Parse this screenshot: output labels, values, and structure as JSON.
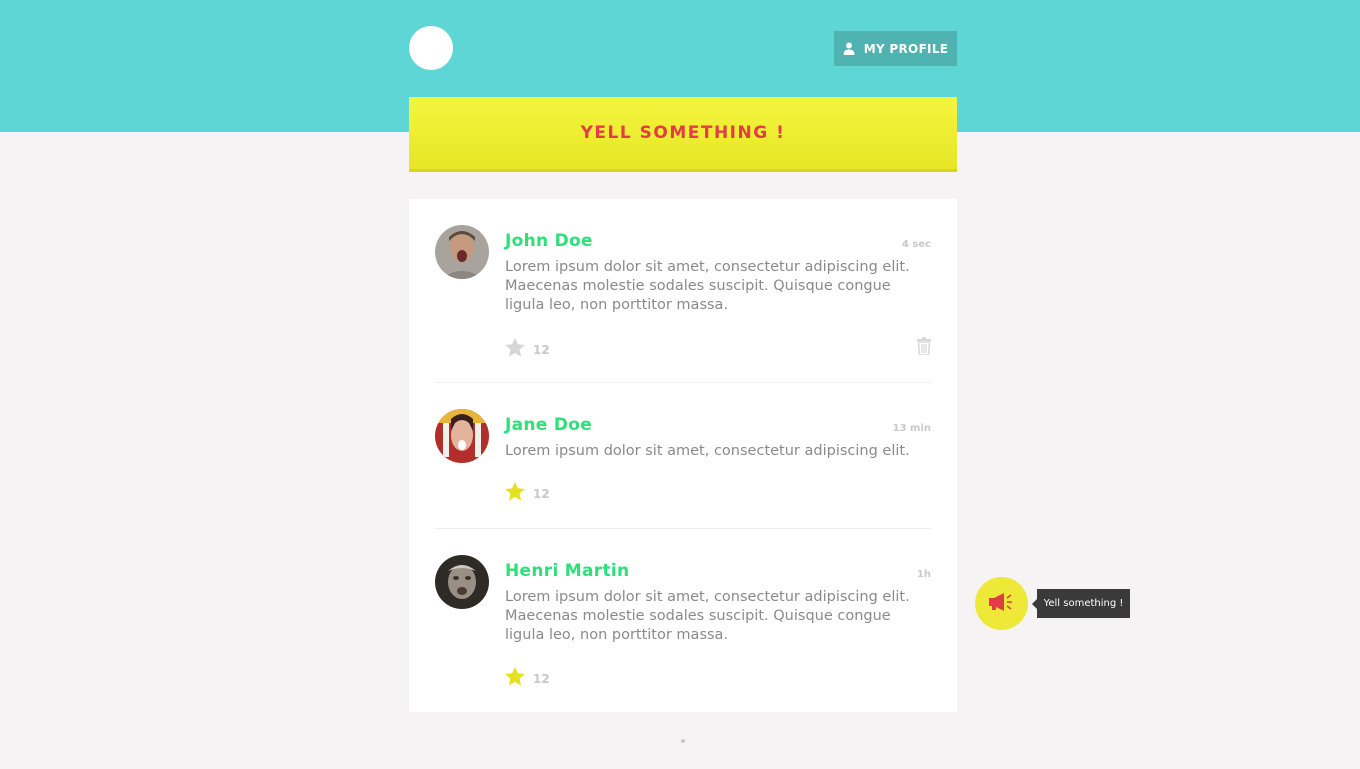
{
  "header": {
    "profile_label": "MY PROFILE",
    "accent_color": "#5fd6d6"
  },
  "yell_bar": {
    "label": "YELL SOMETHING !"
  },
  "posts": [
    {
      "author": "John Doe",
      "time": "4 sec",
      "text": "Lorem ipsum dolor sit amet, consectetur adipiscing elit. Maecenas molestie sodales suscipit. Quisque congue ligula leo, non porttitor massa.",
      "likes": "12",
      "starred": false,
      "deletable": true
    },
    {
      "author": "Jane Doe",
      "time": "13 min",
      "text": "Lorem ipsum dolor sit amet, consectetur adipiscing elit.",
      "likes": "12",
      "starred": true,
      "deletable": false
    },
    {
      "author": "Henri Martin",
      "time": "1h",
      "text": "Lorem ipsum dolor sit amet, consectetur adipiscing elit. Maecenas molestie sodales suscipit. Quisque congue ligula leo, non porttitor massa.",
      "likes": "12",
      "starred": true,
      "deletable": false
    }
  ],
  "fab": {
    "icon": "megaphone-icon",
    "tooltip": "Yell something !"
  },
  "colors": {
    "name": "#2fe07a",
    "star_active": "#e6e023",
    "star_inactive": "#d6d6d6",
    "yell_text": "#e23c46"
  }
}
